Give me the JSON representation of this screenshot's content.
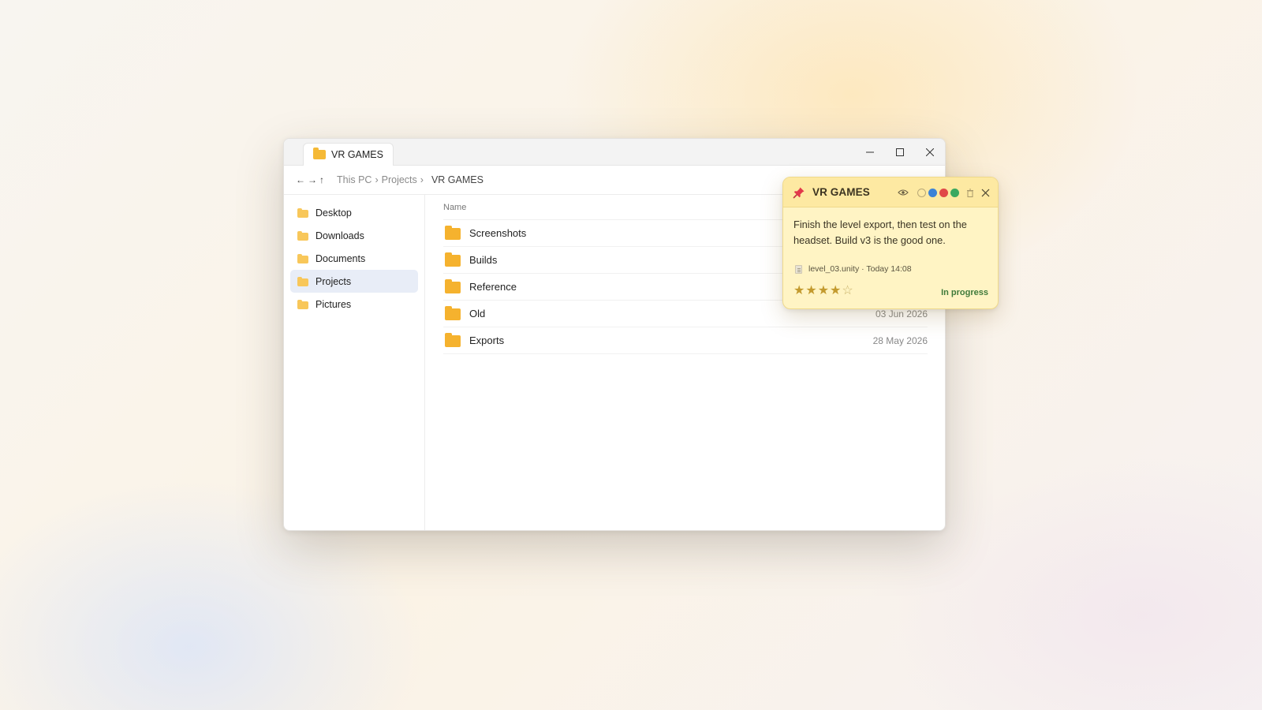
{
  "explorer": {
    "tab_title": "VR GAMES",
    "nav": {
      "back": "←",
      "forward": "→",
      "up": "↑"
    },
    "breadcrumb": [
      "This PC",
      "Projects"
    ],
    "breadcrumb_separator": "›",
    "current_folder": "VR GAMES",
    "sidebar": {
      "items": [
        {
          "label": "Desktop",
          "icon": "folder-icon"
        },
        {
          "label": "Downloads",
          "icon": "folder-icon"
        },
        {
          "label": "Documents",
          "icon": "folder-icon"
        },
        {
          "label": "Projects",
          "icon": "folder-icon",
          "selected": true
        },
        {
          "label": "Pictures",
          "icon": "folder-icon"
        }
      ]
    },
    "columns": {
      "name": "Name"
    },
    "rows": [
      {
        "name": "Screenshots",
        "date": ""
      },
      {
        "name": "Builds",
        "date": ""
      },
      {
        "name": "Reference",
        "date": ""
      },
      {
        "name": "Old",
        "date": "03 Jun 2026"
      },
      {
        "name": "Exports",
        "date": "28 May 2026"
      }
    ]
  },
  "note": {
    "title": "VR GAMES",
    "body": "Finish the level export, then test on the headset. Build v3 is the good one.",
    "attachment": "level_03.unity · Today 14:08",
    "rating": 4,
    "rating_max": 5,
    "status": "In progress",
    "color_options": [
      "none",
      "#3b82d6",
      "#e04848",
      "#3aa860"
    ],
    "colors": {
      "background": "#fff4c4",
      "header": "#fde9a2",
      "status": "#3f7a3a"
    }
  },
  "theme": {
    "folder": "#f5b22e",
    "selection": "#e8edf7"
  }
}
